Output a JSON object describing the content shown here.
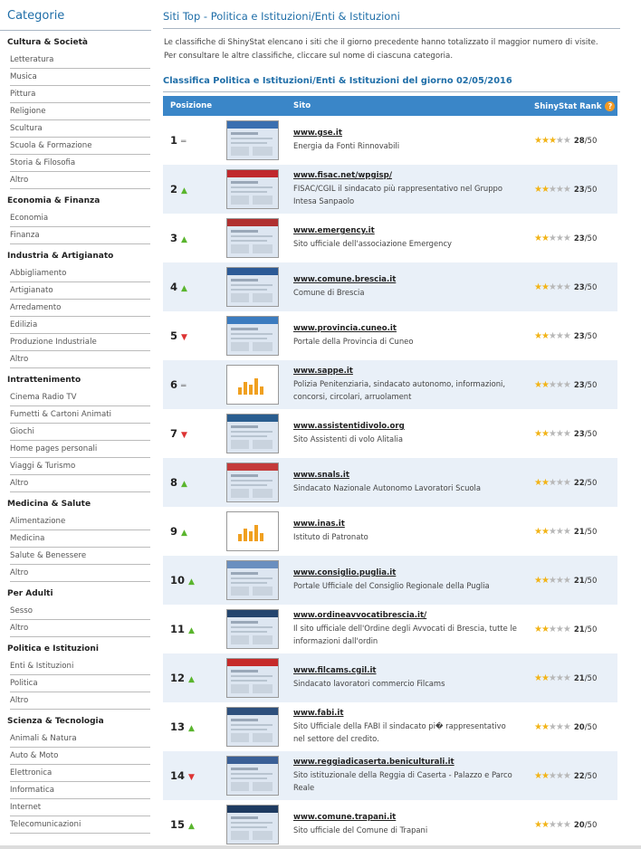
{
  "sidebar": {
    "title": "Categorie",
    "groups": [
      {
        "name": "Cultura & Società",
        "items": [
          "Letteratura",
          "Musica",
          "Pittura",
          "Religione",
          "Scultura",
          "Scuola & Formazione",
          "Storia & Filosofia",
          "Altro"
        ]
      },
      {
        "name": "Economia & Finanza",
        "items": [
          "Economia",
          "Finanza"
        ]
      },
      {
        "name": "Industria & Artigianato",
        "items": [
          "Abbigliamento",
          "Artigianato",
          "Arredamento",
          "Edilizia",
          "Produzione Industriale",
          "Altro"
        ]
      },
      {
        "name": "Intrattenimento",
        "items": [
          "Cinema Radio TV",
          "Fumetti & Cartoni Animati",
          "Giochi",
          "Home pages personali",
          "Viaggi & Turismo",
          "Altro"
        ]
      },
      {
        "name": "Medicina & Salute",
        "items": [
          "Alimentazione",
          "Medicina",
          "Salute & Benessere",
          "Altro"
        ]
      },
      {
        "name": "Per Adulti",
        "items": [
          "Sesso",
          "Altro"
        ]
      },
      {
        "name": "Politica e Istituzioni",
        "items": [
          "Enti & Istituzioni",
          "Politica",
          "Altro"
        ]
      },
      {
        "name": "Scienza & Tecnologia",
        "items": [
          "Animali & Natura",
          "Auto & Moto",
          "Elettronica",
          "Informatica",
          "Internet",
          "Telecomunicazioni"
        ]
      }
    ]
  },
  "main": {
    "title": "Siti Top - Politica e Istituzioni/Enti & Istituzioni",
    "desc1": "Le classifiche di ShinyStat elencano i siti che il giorno precedente hanno totalizzato il maggior numero di visite.",
    "desc2": "Per consultare le altre classifiche, cliccare sul nome di ciascuna categoria.",
    "subtitle": "Classifica Politica e Istituzioni/Enti & Istituzioni del giorno 02/05/2016",
    "headers": {
      "position": "Posizione",
      "site": "Sito",
      "rank": "ShinyStat Rank"
    },
    "colors": {
      "accent": "#1f6ea8",
      "header_bg": "#3a86c8",
      "row_alt": "#e9f0f8",
      "up": "#5ab52e",
      "down": "#dd3333",
      "star": "#f2b418"
    },
    "rows": [
      {
        "pos": "1",
        "trend": "eq",
        "url": "www.gse.it",
        "desc": "Energia da Fonti Rinnovabili",
        "stars": 3,
        "score": "28",
        "max": "/50",
        "thumb": "#3a6fb0"
      },
      {
        "pos": "2",
        "trend": "up",
        "url": "www.fisac.net/wpgisp/",
        "desc": "FISAC/CGIL il sindacato più rappresentativo nel Gruppo Intesa Sanpaolo",
        "stars": 2,
        "score": "23",
        "max": "/50",
        "thumb": "#c0282d"
      },
      {
        "pos": "3",
        "trend": "up",
        "url": "www.emergency.it",
        "desc": "Sito ufficiale dell'associazione Emergency",
        "stars": 2,
        "score": "23",
        "max": "/50",
        "thumb": "#b03030"
      },
      {
        "pos": "4",
        "trend": "up",
        "url": "www.comune.brescia.it",
        "desc": "Comune di Brescia",
        "stars": 2,
        "score": "23",
        "max": "/50",
        "thumb": "#2c5a96"
      },
      {
        "pos": "5",
        "trend": "down",
        "url": "www.provincia.cuneo.it",
        "desc": "Portale della Provincia di Cuneo",
        "stars": 2,
        "score": "23",
        "max": "/50",
        "thumb": "#3b7bbf"
      },
      {
        "pos": "6",
        "trend": "eq",
        "url": "www.sappe.it",
        "desc": "Polizia Penitenziaria, sindacato autonomo, informazioni, concorsi, circolari, arruolament",
        "stars": 2,
        "score": "23",
        "max": "/50",
        "thumb": "placeholder"
      },
      {
        "pos": "7",
        "trend": "down",
        "url": "www.assistentidivolo.org",
        "desc": "Sito Assistenti di volo Alitalia",
        "stars": 2,
        "score": "23",
        "max": "/50",
        "thumb": "#2a5d8f"
      },
      {
        "pos": "8",
        "trend": "up",
        "url": "www.snals.it",
        "desc": "Sindacato Nazionale Autonomo Lavoratori Scuola",
        "stars": 2,
        "score": "22",
        "max": "/50",
        "thumb": "#c43a3a"
      },
      {
        "pos": "9",
        "trend": "up",
        "url": "www.inas.it",
        "desc": "Istituto di Patronato",
        "stars": 2,
        "score": "21",
        "max": "/50",
        "thumb": "placeholder"
      },
      {
        "pos": "10",
        "trend": "up",
        "url": "www.consiglio.puglia.it",
        "desc": "Portale Ufficiale del Consiglio Regionale della Puglia",
        "stars": 2,
        "score": "21",
        "max": "/50",
        "thumb": "#6a8fbf"
      },
      {
        "pos": "11",
        "trend": "up",
        "url": "www.ordineavvocatibrescia.it/",
        "desc": "Il sito ufficiale dell'Ordine degli Avvocati di Brescia, tutte le informazioni dall'ordin",
        "stars": 2,
        "score": "21",
        "max": "/50",
        "thumb": "#24456e"
      },
      {
        "pos": "12",
        "trend": "up",
        "url": "www.filcams.cgil.it",
        "desc": "Sindacato lavoratori commercio Filcams",
        "stars": 2,
        "score": "21",
        "max": "/50",
        "thumb": "#c62a2a"
      },
      {
        "pos": "13",
        "trend": "up",
        "url": "www.fabi.it",
        "desc": "Sito Ufficiale della FABI il sindacato pi� rappresentativo nel settore del credito.",
        "stars": 2,
        "score": "20",
        "max": "/50",
        "thumb": "#2d4f7c"
      },
      {
        "pos": "14",
        "trend": "down",
        "url": "www.reggiadicaserta.beniculturali.it",
        "desc": "Sito istituzionale della Reggia di Caserta - Palazzo e Parco Reale",
        "stars": 2,
        "score": "22",
        "max": "/50",
        "thumb": "#3a5f96"
      },
      {
        "pos": "15",
        "trend": "up",
        "url": "www.comune.trapani.it",
        "desc": "Sito ufficiale del Comune di Trapani",
        "stars": 2,
        "score": "20",
        "max": "/50",
        "thumb": "#1e3a60"
      }
    ]
  }
}
